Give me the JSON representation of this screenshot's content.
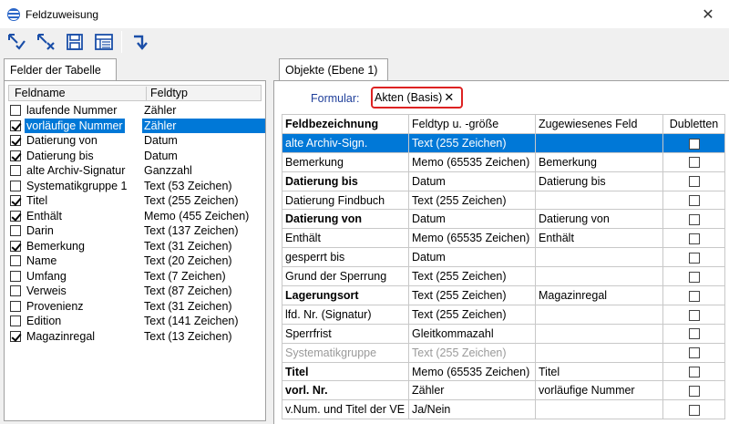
{
  "window": {
    "title": "Feldzuweisung",
    "close_label": "✕"
  },
  "toolbar": {
    "buttons": [
      {
        "name": "assign-icon"
      },
      {
        "name": "unassign-icon"
      },
      {
        "name": "save-icon"
      },
      {
        "name": "list-icon"
      },
      {
        "name": "return-arrow-icon"
      }
    ]
  },
  "left": {
    "tab_label": "Felder der Tabelle",
    "header": {
      "col1": "Feldname",
      "col2": "Feldtyp"
    },
    "fields": [
      {
        "name": "laufende Nummer",
        "type": "Zähler",
        "checked": false
      },
      {
        "name": "vorläufige Nummer",
        "type": "Zähler",
        "checked": true,
        "selected": true
      },
      {
        "name": "Datierung von",
        "type": "Datum",
        "checked": true
      },
      {
        "name": "Datierung bis",
        "type": "Datum",
        "checked": true
      },
      {
        "name": "alte Archiv-Signatur",
        "type": "Ganzzahl",
        "checked": false
      },
      {
        "name": "Systematikgruppe 1",
        "type": "Text (53 Zeichen)",
        "checked": false
      },
      {
        "name": "Titel",
        "type": "Text (255 Zeichen)",
        "checked": true
      },
      {
        "name": "Enthält",
        "type": "Memo (455 Zeichen)",
        "checked": true
      },
      {
        "name": "Darin",
        "type": "Text (137 Zeichen)",
        "checked": false
      },
      {
        "name": "Bemerkung",
        "type": "Text (31 Zeichen)",
        "checked": true
      },
      {
        "name": "Name",
        "type": "Text (20 Zeichen)",
        "checked": false
      },
      {
        "name": "Umfang",
        "type": "Text (7 Zeichen)",
        "checked": false
      },
      {
        "name": "Verweis",
        "type": "Text (87 Zeichen)",
        "checked": false
      },
      {
        "name": "Provenienz",
        "type": "Text (31 Zeichen)",
        "checked": false
      },
      {
        "name": "Edition",
        "type": "Text (141 Zeichen)",
        "checked": false
      },
      {
        "name": "Magazinregal",
        "type": "Text (13 Zeichen)",
        "checked": true
      }
    ]
  },
  "right": {
    "tab_label": "Objekte (Ebene 1)",
    "formular_label": "Formular:",
    "formular_value": "Akten (Basis)",
    "formular_clear": "✕",
    "columns": [
      "Feldbezeichnung",
      "Feldtyp u. -größe",
      "Zugewiesenes Feld",
      "Dubletten"
    ],
    "rows": [
      {
        "field": "alte Archiv-Sign.",
        "type": "Text (255 Zeichen)",
        "assigned": "",
        "bold": false,
        "selected": true,
        "grey": false
      },
      {
        "field": "Bemerkung",
        "type": "Memo (65535 Zeichen)",
        "assigned": "Bemerkung",
        "bold": false,
        "selected": false,
        "grey": false
      },
      {
        "field": "Datierung bis",
        "type": "Datum",
        "assigned": "Datierung bis",
        "bold": true,
        "selected": false,
        "grey": false
      },
      {
        "field": "Datierung Findbuch",
        "type": "Text (255 Zeichen)",
        "assigned": "",
        "bold": false,
        "selected": false,
        "grey": false
      },
      {
        "field": "Datierung von",
        "type": "Datum",
        "assigned": "Datierung von",
        "bold": true,
        "selected": false,
        "grey": false
      },
      {
        "field": "Enthält",
        "type": "Memo (65535 Zeichen)",
        "assigned": "Enthält",
        "bold": false,
        "selected": false,
        "grey": false
      },
      {
        "field": "gesperrt bis",
        "type": "Datum",
        "assigned": "",
        "bold": false,
        "selected": false,
        "grey": false
      },
      {
        "field": "Grund der Sperrung",
        "type": "Text (255 Zeichen)",
        "assigned": "",
        "bold": false,
        "selected": false,
        "grey": false
      },
      {
        "field": "Lagerungsort",
        "type": "Text (255 Zeichen)",
        "assigned": "Magazinregal",
        "bold": true,
        "selected": false,
        "grey": false
      },
      {
        "field": "lfd. Nr. (Signatur)",
        "type": "Text (255 Zeichen)",
        "assigned": "",
        "bold": false,
        "selected": false,
        "grey": false
      },
      {
        "field": "Sperrfrist",
        "type": "Gleitkommazahl",
        "assigned": "",
        "bold": false,
        "selected": false,
        "grey": false
      },
      {
        "field": "Systematikgruppe",
        "type": "Text (255 Zeichen)",
        "assigned": "",
        "bold": false,
        "selected": false,
        "grey": true
      },
      {
        "field": "Titel",
        "type": "Memo (65535 Zeichen)",
        "assigned": "Titel",
        "bold": true,
        "selected": false,
        "grey": false
      },
      {
        "field": "vorl. Nr.",
        "type": "Zähler",
        "assigned": "vorläufige Nummer",
        "bold": true,
        "selected": false,
        "grey": false
      },
      {
        "field": "v.Num. und Titel der VE",
        "type": "Ja/Nein",
        "assigned": "",
        "bold": false,
        "selected": false,
        "grey": false
      }
    ]
  }
}
